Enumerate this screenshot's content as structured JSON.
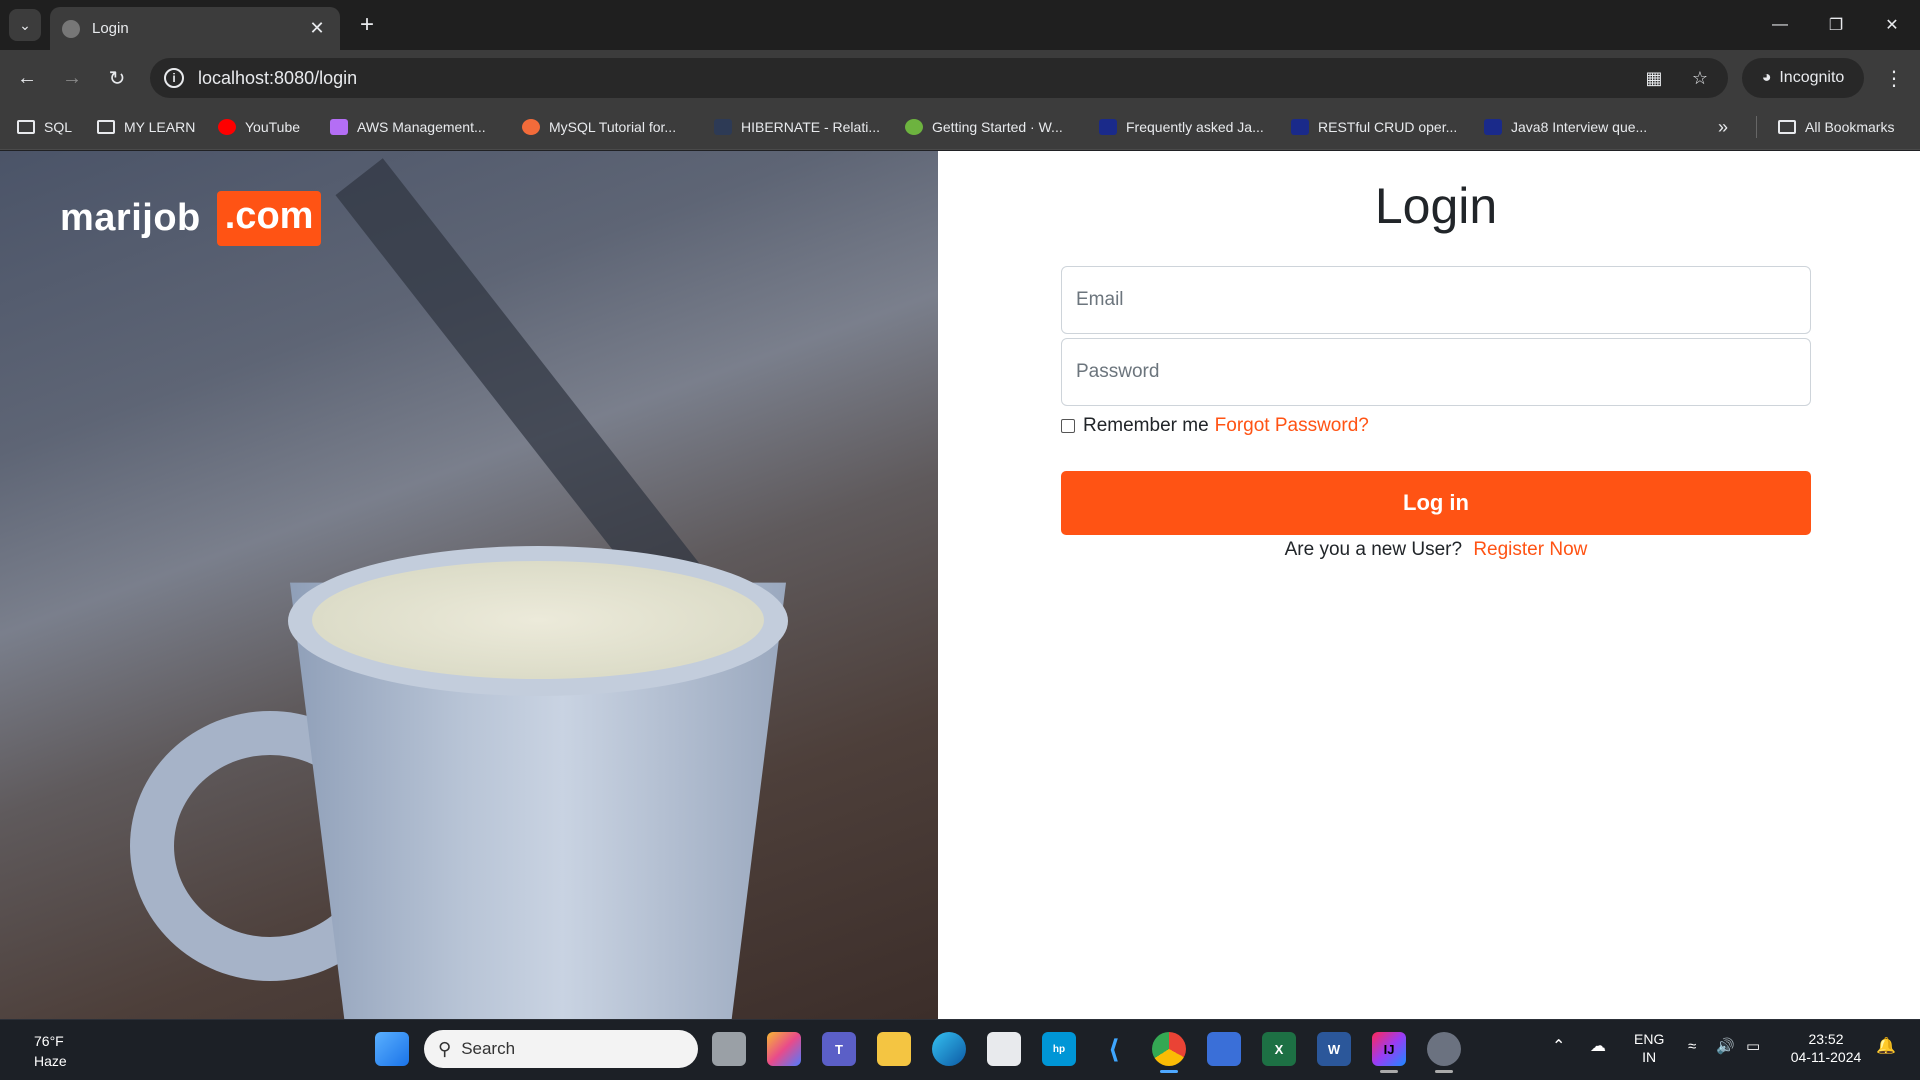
{
  "browser": {
    "tab_title": "Login",
    "url": "localhost:8080/login",
    "incognito_label": "Incognito",
    "bookmarks": [
      {
        "label": "SQL",
        "icon": "folder-icon",
        "color": "#e8eaed"
      },
      {
        "label": "MY LEARN",
        "icon": "folder-icon",
        "color": "#e8eaed"
      },
      {
        "label": "YouTube",
        "icon": "youtube-icon",
        "color": "#ff0000"
      },
      {
        "label": "AWS Management...",
        "icon": "aws-cube-icon",
        "color": "#b46ef5"
      },
      {
        "label": "MySQL Tutorial for...",
        "icon": "mysql-icon",
        "color": "#f26b3a"
      },
      {
        "label": "HIBERNATE - Relati...",
        "icon": "page-icon",
        "color": "#2d3a55"
      },
      {
        "label": "Getting Started · W...",
        "icon": "spring-leaf-icon",
        "color": "#6db33f"
      },
      {
        "label": "Frequently asked Ja...",
        "icon": "site-thumb-icon",
        "color": "#1a2a8a"
      },
      {
        "label": "RESTful CRUD oper...",
        "icon": "site-thumb-icon",
        "color": "#1a2a8a"
      },
      {
        "label": "Java8 Interview que...",
        "icon": "site-thumb-icon",
        "color": "#1a2a8a"
      }
    ],
    "all_bookmarks": "All Bookmarks"
  },
  "page": {
    "brand_name": "marijob",
    "brand_suffix": ".com",
    "title": "Login",
    "email_placeholder": "Email",
    "password_placeholder": "Password",
    "remember_label": "Remember me",
    "forgot_link": "Forgot Password?",
    "login_button": "Log in",
    "new_user_text": "Are you a new User?",
    "register_link": "Register Now",
    "accent_color": "#ff5314"
  },
  "taskbar": {
    "temperature": "76°F",
    "weather": "Haze",
    "search_placeholder": "Search",
    "language": "ENG",
    "region": "IN",
    "time": "23:52",
    "date": "04-11-2024"
  }
}
